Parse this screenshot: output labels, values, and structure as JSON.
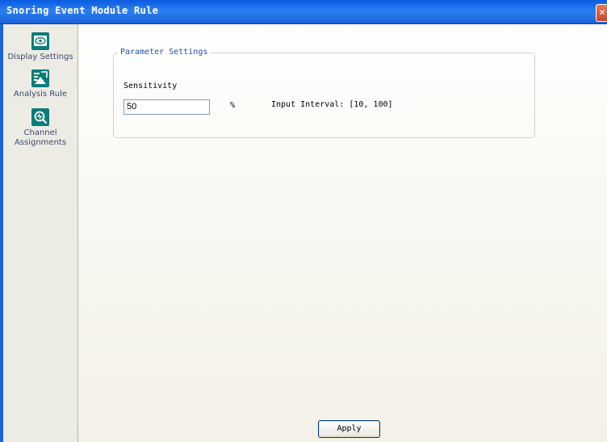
{
  "window": {
    "title": "Snoring Event Module Rule",
    "close_glyph": "✕"
  },
  "sidebar": {
    "items": [
      {
        "label": "Display Settings",
        "icon": "eye-icon"
      },
      {
        "label": "Analysis Rule",
        "icon": "analysis-chart-icon"
      },
      {
        "label": "Channel Assignments",
        "icon": "channel-search-icon"
      }
    ]
  },
  "parameters": {
    "group_title": "Parameter Settings",
    "sensitivity_label": "Sensitivity",
    "sensitivity_value": "50",
    "unit": "%",
    "interval_text": "Input Interval: [10, 100]"
  },
  "footer": {
    "apply_label": "Apply"
  },
  "colors": {
    "titlebar": "#1a63d8",
    "icon_teal": "#0a7d79",
    "legend_blue": "#1f4fa8"
  }
}
